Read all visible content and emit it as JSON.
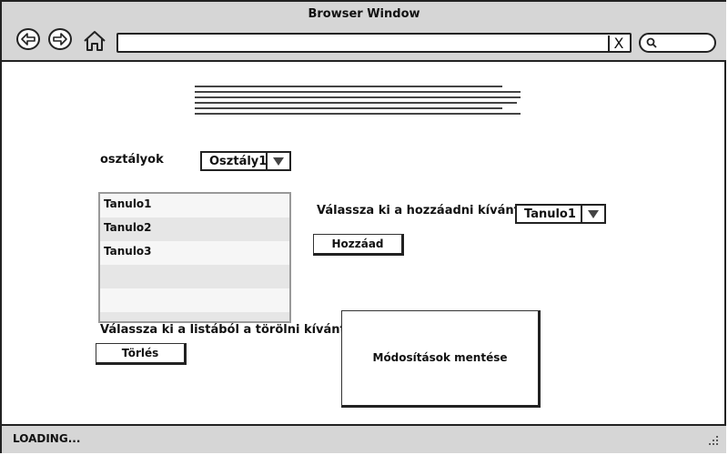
{
  "window": {
    "title": "Browser Window"
  },
  "toolbar": {
    "back_icon": "arrow-left-icon",
    "forward_icon": "arrow-right-icon",
    "home_icon": "home-icon",
    "url_value": "",
    "url_clear": "X",
    "search_icon": "search-icon"
  },
  "form": {
    "class_label": "osztályok",
    "class_select": "Osztály1",
    "students": [
      "Tanulo1",
      "Tanulo2",
      "Tanulo3",
      "",
      "",
      ""
    ],
    "add_label": "Válassza ki a hozzáadni kívánt tanulót",
    "student_select": "Tanulo1",
    "add_button": "Hozzáad",
    "delete_label": "Válassza ki a listából a törölni kívánt tanulót",
    "delete_button": "Törlés",
    "save_button": "Módosítások mentése"
  },
  "status": {
    "text": "LOADING..."
  }
}
